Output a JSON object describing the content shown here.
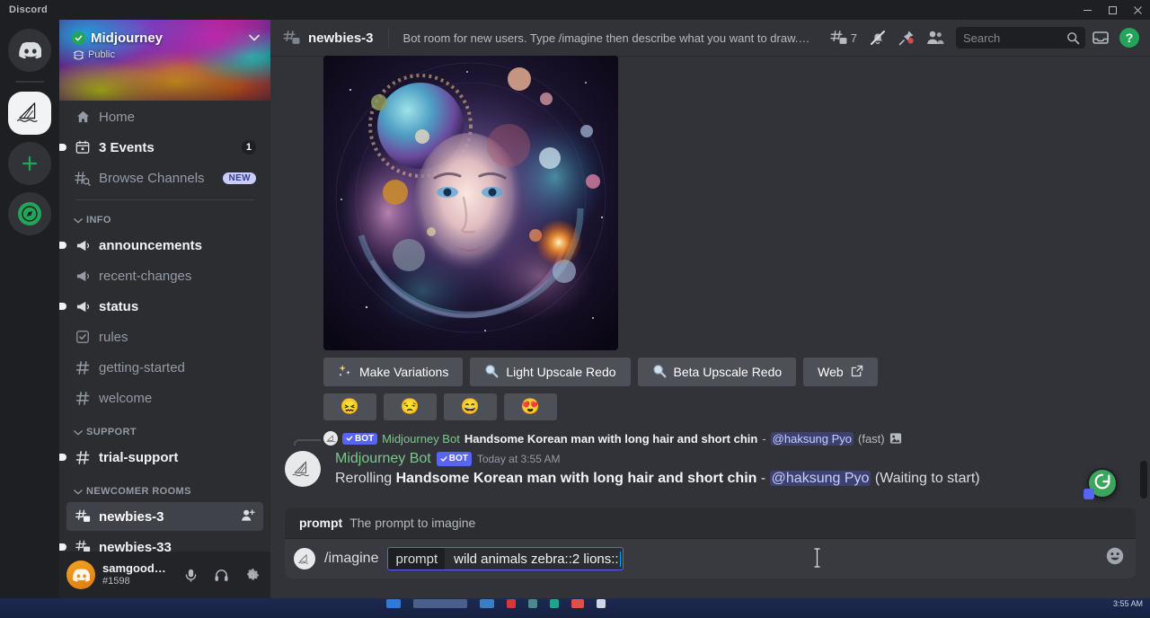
{
  "window": {
    "title": "Discord",
    "minimize_label": "—",
    "maximize_label": "❐",
    "close_label": "✕"
  },
  "guild_rail": {
    "items": [
      {
        "name": "discord-home",
        "label": "Home"
      },
      {
        "name": "midjourney-server",
        "label": "Midjourney"
      },
      {
        "name": "add-server",
        "label": "+"
      },
      {
        "name": "explore-servers",
        "label": "Explore Public Servers"
      }
    ]
  },
  "sidebar": {
    "guild_name": "Midjourney",
    "guild_privacy": "Public",
    "nav": [
      {
        "label": "Home",
        "icon": "home-icon",
        "badge": "",
        "badge_type": ""
      },
      {
        "label": "3 Events",
        "icon": "calendar-icon",
        "badge": "1",
        "badge_type": "count"
      },
      {
        "label": "Browse Channels",
        "icon": "browse-channels-icon",
        "badge": "NEW",
        "badge_type": "new"
      }
    ],
    "categories": [
      {
        "label": "INFO",
        "channels": [
          {
            "label": "announcements",
            "icon": "announcement-icon",
            "unread": true,
            "selected": false
          },
          {
            "label": "recent-changes",
            "icon": "announcement-icon",
            "unread": false,
            "selected": false
          },
          {
            "label": "status",
            "icon": "announcement-icon",
            "unread": true,
            "selected": false
          },
          {
            "label": "rules",
            "icon": "rules-icon",
            "unread": false,
            "selected": false
          },
          {
            "label": "getting-started",
            "icon": "hash-icon",
            "unread": false,
            "selected": false
          },
          {
            "label": "welcome",
            "icon": "hash-icon",
            "unread": false,
            "selected": false
          }
        ]
      },
      {
        "label": "SUPPORT",
        "channels": [
          {
            "label": "trial-support",
            "icon": "hash-icon",
            "unread": true,
            "selected": false
          }
        ]
      },
      {
        "label": "NEWCOMER ROOMS",
        "channels": [
          {
            "label": "newbies-3",
            "icon": "thread-hash-icon",
            "unread": false,
            "selected": true
          },
          {
            "label": "newbies-33",
            "icon": "thread-hash-icon",
            "unread": true,
            "selected": false
          }
        ]
      }
    ],
    "user": {
      "name": "samgoodw...",
      "discriminator": "#1598",
      "controls": [
        "microphone-icon",
        "headphones-icon",
        "gear-icon"
      ]
    }
  },
  "channel_header": {
    "channel_name": "newbies-3",
    "topic": "Bot room for new users. Type /imagine then describe what you want to draw. S…",
    "threads_count": "7",
    "icons": [
      "threads-icon",
      "notification-muted-icon",
      "pinned-messages-icon",
      "member-list-icon"
    ],
    "search_placeholder": "Search",
    "search_value": "",
    "inbox_icon": "inbox-icon",
    "help_icon": "help-icon"
  },
  "message_area": {
    "attachment_alt": "Midjourney generated cosmic portrait",
    "action_buttons": [
      {
        "label": "Make Variations",
        "icon": "sparkles-icon"
      },
      {
        "label": "Light Upscale Redo",
        "icon": "magnifier-icon"
      },
      {
        "label": "Beta Upscale Redo",
        "icon": "magnifier-icon"
      },
      {
        "label": "Web",
        "icon": "external-link-icon"
      }
    ],
    "emoji_buttons": [
      {
        "name": "emoji-confounded",
        "glyph": "😖"
      },
      {
        "name": "emoji-unamused",
        "glyph": "😒"
      },
      {
        "name": "emoji-grinning",
        "glyph": "😄"
      },
      {
        "name": "emoji-heart-eyes",
        "glyph": "😍"
      }
    ],
    "reply_context": {
      "bot_tag": "BOT",
      "author": "Midjourney Bot",
      "prompt": "Handsome Korean man with long hair and short chin",
      "separator": "-",
      "mention": "@haksung Pyo",
      "suffix": "(fast)",
      "image_icon": "image-icon"
    },
    "message": {
      "author": "Midjourney Bot",
      "bot_tag": "BOT",
      "timestamp": "Today at 3:55 AM",
      "text_prefix": "Rerolling",
      "prompt": "Handsome Korean man with long hair and short chin",
      "separator": "-",
      "mention": "@haksung Pyo",
      "suffix": "(Waiting to start)"
    }
  },
  "composer": {
    "slash_hint_key": "prompt",
    "slash_hint_desc": "The prompt to imagine",
    "command_name": "/imagine",
    "chip_key": "prompt",
    "chip_value": "wild animals zebra::2 lions::",
    "emoji_picker_icon": "emoji-picker-icon",
    "fab_icon": "reload-icon"
  },
  "taskbar": {
    "clock": "3:55 AM"
  },
  "colors": {
    "accent_blurple": "#5865f2",
    "green": "#23a559",
    "bot_name_green": "#7cc98b",
    "sidebar_bg": "#2b2d31",
    "main_bg": "#313338",
    "rail_bg": "#1e1f22"
  }
}
